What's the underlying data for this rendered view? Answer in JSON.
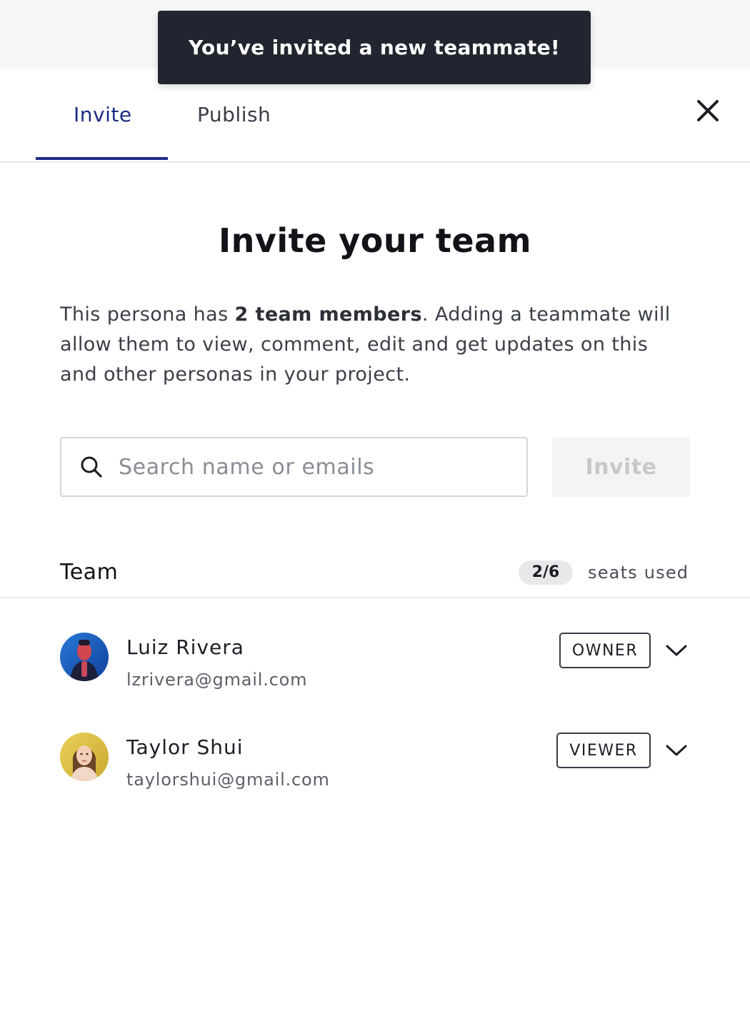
{
  "toast": {
    "message": "You’ve invited a new teammate!"
  },
  "tabs": [
    {
      "label": "Invite",
      "active": true
    },
    {
      "label": "Publish",
      "active": false
    }
  ],
  "close_icon": "close-icon",
  "title": "Invite your team",
  "description": {
    "part1": "This persona has ",
    "bold": "2 team members",
    "part2": ". Adding a teammate will allow them to view, comment, edit and get updates on this and other personas in your project."
  },
  "search": {
    "placeholder": "Search name or emails",
    "value": "",
    "icon": "search-icon"
  },
  "invite_button": {
    "label": "Invite",
    "enabled": false
  },
  "team": {
    "label": "Team",
    "seats_badge": "2/6",
    "seats_text": "seats used",
    "members": [
      {
        "name": "Luiz Rivera",
        "email": "lzrivera@gmail.com",
        "role": "OWNER"
      },
      {
        "name": "Taylor Shui",
        "email": "taylorshui@gmail.com",
        "role": "VIEWER"
      }
    ]
  },
  "colors": {
    "accent": "#1c2c84",
    "toast_bg": "#21252f",
    "disabled_button_bg": "#f4f4f5",
    "disabled_button_text": "#c7c8cc"
  }
}
